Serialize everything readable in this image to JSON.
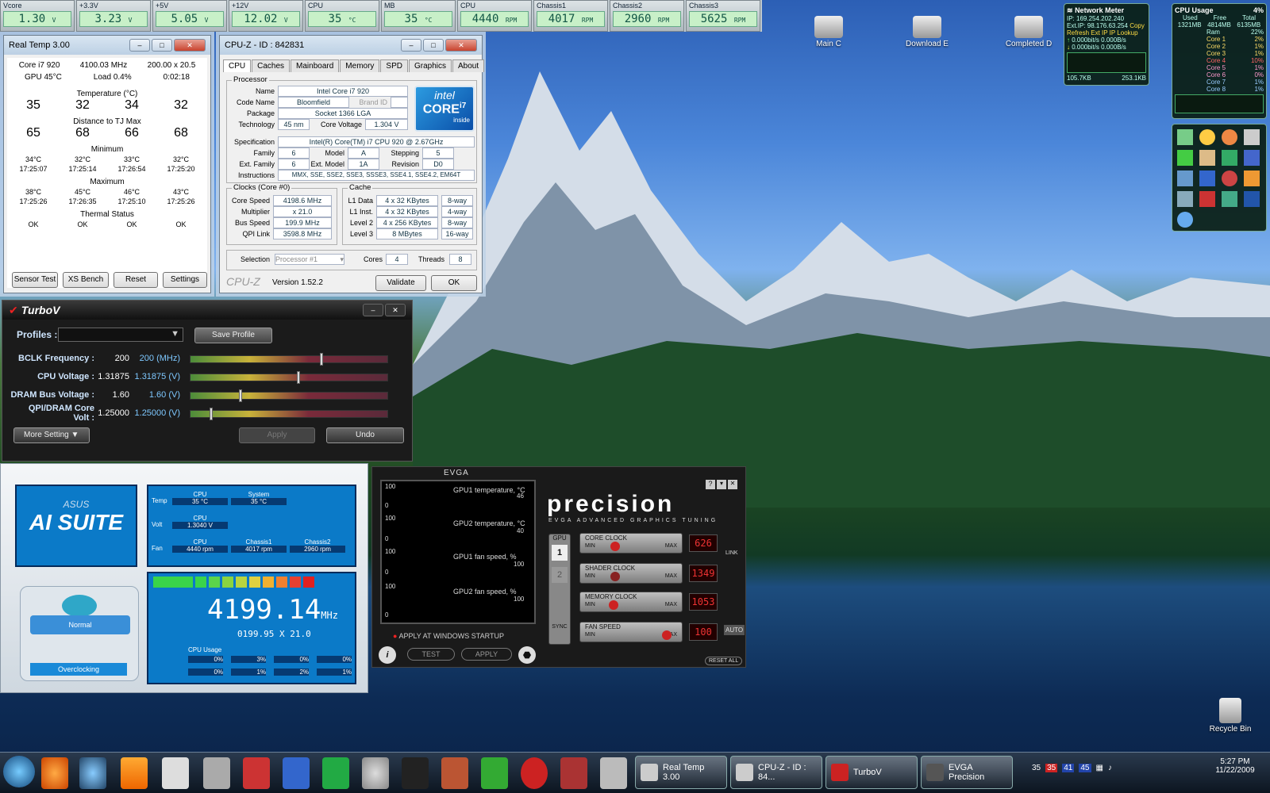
{
  "sensors": [
    {
      "label": "Vcore",
      "value": "1.30",
      "unit": "V"
    },
    {
      "label": "+3.3V",
      "value": "3.23",
      "unit": "V"
    },
    {
      "label": "+5V",
      "value": "5.05",
      "unit": "V"
    },
    {
      "label": "+12V",
      "value": "12.02",
      "unit": "V"
    },
    {
      "label": "CPU",
      "value": "35",
      "unit": "°C"
    },
    {
      "label": "MB",
      "value": "35",
      "unit": "°C"
    },
    {
      "label": "CPU",
      "value": "4440",
      "unit": "RPM"
    },
    {
      "label": "Chassis1",
      "value": "4017",
      "unit": "RPM"
    },
    {
      "label": "Chassis2",
      "value": "2960",
      "unit": "RPM"
    },
    {
      "label": "Chassis3",
      "value": "5625",
      "unit": "RPM"
    }
  ],
  "realtemp": {
    "title": "Real Temp 3.00",
    "cpu": "Core i7 920",
    "mhz": "4100.03 MHz",
    "mult": "200.00 x 20.5",
    "gpu": "GPU 45°C",
    "load": "Load 0.4%",
    "time": "0:02:18",
    "temp_label": "Temperature (°C)",
    "temps": [
      "35",
      "32",
      "34",
      "32"
    ],
    "dist_label": "Distance to TJ Max",
    "dist": [
      "65",
      "68",
      "66",
      "68"
    ],
    "min_label": "Minimum",
    "min_t": [
      "34°C",
      "32°C",
      "33°C",
      "32°C"
    ],
    "min_time": [
      "17:25:07",
      "17:25:14",
      "17:26:54",
      "17:25:20"
    ],
    "max_label": "Maximum",
    "max_t": [
      "38°C",
      "45°C",
      "46°C",
      "43°C"
    ],
    "max_time": [
      "17:25:26",
      "17:26:35",
      "17:25:10",
      "17:25:26"
    ],
    "thermal_label": "Thermal Status",
    "thermal": [
      "OK",
      "OK",
      "OK",
      "OK"
    ],
    "buttons": [
      "Sensor Test",
      "XS Bench",
      "Reset",
      "Settings"
    ]
  },
  "cpuz": {
    "title": "CPU-Z - ID : 842831",
    "tabs": [
      "CPU",
      "Caches",
      "Mainboard",
      "Memory",
      "SPD",
      "Graphics",
      "About"
    ],
    "proc_label": "Processor",
    "name_l": "Name",
    "name": "Intel Core i7 920",
    "code_l": "Code Name",
    "code": "Bloomfield",
    "brand_l": "Brand ID",
    "pkg_l": "Package",
    "pkg": "Socket 1366 LGA",
    "tech_l": "Technology",
    "tech": "45 nm",
    "cv_l": "Core Voltage",
    "cv": "1.304 V",
    "spec_l": "Specification",
    "spec": "Intel(R) Core(TM) i7 CPU     920  @ 2.67GHz",
    "fam_l": "Family",
    "fam": "6",
    "model_l": "Model",
    "model": "A",
    "step_l": "Stepping",
    "step": "5",
    "efam_l": "Ext. Family",
    "efam": "6",
    "emodel_l": "Ext. Model",
    "emodel": "1A",
    "rev_l": "Revision",
    "rev": "D0",
    "instr_l": "Instructions",
    "instr": "MMX, SSE, SSE2, SSE3, SSSE3, SSE4.1, SSE4.2, EM64T",
    "clocks_label": "Clocks (Core #0)",
    "cs_l": "Core Speed",
    "cs": "4198.6 MHz",
    "mul_l": "Multiplier",
    "mul": "x 21.0",
    "bs_l": "Bus Speed",
    "bs": "199.9 MHz",
    "qpi_l": "QPI Link",
    "qpi": "3598.8 MHz",
    "cache_label": "Cache",
    "l1d_l": "L1 Data",
    "l1d": "4 x 32 KBytes",
    "l1d_w": "8-way",
    "l1i_l": "L1 Inst.",
    "l1i": "4 x 32 KBytes",
    "l1i_w": "4-way",
    "l2_l": "Level 2",
    "l2": "4 x 256 KBytes",
    "l2_w": "8-way",
    "l3_l": "Level 3",
    "l3": "8 MBytes",
    "l3_w": "16-way",
    "sel_l": "Selection",
    "sel": "Processor #1",
    "cores_l": "Cores",
    "cores": "4",
    "thr_l": "Threads",
    "thr": "8",
    "brand": "CPU-Z",
    "version": "Version 1.52.2",
    "validate": "Validate",
    "ok": "OK",
    "logo_top": "intel",
    "logo_mid": "CORE",
    "logo_i7": "i7",
    "logo_bot": "inside"
  },
  "turbov": {
    "title": "TurboV",
    "profiles_l": "Profiles :",
    "save": "Save Profile",
    "rows": [
      {
        "label": "BCLK Frequency :",
        "value": "200",
        "set": "200 (MHz)",
        "level": 0.67
      },
      {
        "label": "CPU Voltage :",
        "value": "1.31875",
        "set": "1.31875 (V)",
        "level": 0.55
      },
      {
        "label": "DRAM Bus Voltage :",
        "value": "1.60",
        "set": "1.60 (V)",
        "level": 0.25
      },
      {
        "label": "QPI/DRAM Core Volt :",
        "value": "1.25000",
        "set": "1.25000 (V)",
        "level": 0.1
      }
    ],
    "more": "More Setting",
    "apply": "Apply",
    "undo": "Undo"
  },
  "aisuite": {
    "logo_top": "ASUS",
    "logo": "AI SUITE",
    "temp_l": "Temp",
    "volt_l": "Volt",
    "fan_l": "Fan",
    "cpu_l": "CPU",
    "sys_l": "System",
    "ch1_l": "Chassis1",
    "ch2_l": "Chassis2",
    "cpu_t": "35 °C",
    "sys_t": "35 °C",
    "cpu_v": "1.3040  V",
    "cpu_f": "4440  rpm",
    "ch1_f": "4017  rpm",
    "ch2_f": "2960  rpm",
    "freq": "4199.14",
    "freq_unit": "MHz",
    "freq_sub": "0199.95  X  21.0",
    "usage_l": "CPU Usage",
    "usage_row1": [
      "0%",
      "3%",
      "0%",
      "0%"
    ],
    "usage_row2": [
      "0%",
      "1%",
      "2%",
      "1%"
    ],
    "mode": "Normal",
    "oc": "Overclocking"
  },
  "evga": {
    "brand": "EVGA",
    "graphs": [
      {
        "label": "GPU1 temperature, °C",
        "top": "100",
        "bot": "0",
        "cur": "46"
      },
      {
        "label": "GPU2 temperature, °C",
        "top": "100",
        "bot": "0",
        "cur": "40"
      },
      {
        "label": "GPU1 fan speed, %",
        "top": "100",
        "bot": "0",
        "cur": "100"
      },
      {
        "label": "GPU2 fan speed, %",
        "top": "100",
        "bot": "0",
        "cur": "100"
      }
    ],
    "startup": "APPLY AT WINDOWS STARTUP",
    "test": "TEST",
    "apply": "APPLY",
    "title": "precision",
    "subtitle": "EVGA ADVANCED GRAPHICS TUNING",
    "gpu_l": "GPU",
    "gpu1": "1",
    "gpu2": "2",
    "sync": "SYNC",
    "link": "LINK",
    "auto": "AUTO",
    "reset": "RESET ALL",
    "sliders": [
      {
        "label": "CORE CLOCK",
        "val": "626",
        "level": 0.3
      },
      {
        "label": "SHADER CLOCK",
        "val": "1349",
        "level": 0.3
      },
      {
        "label": "MEMORY CLOCK",
        "val": "1053",
        "level": 0.28
      },
      {
        "label": "FAN SPEED",
        "val": "100",
        "level": 0.95
      }
    ],
    "min": "MIN",
    "max": "MAX"
  },
  "network": {
    "title": "Network Meter",
    "ip": "IP: 169.254.202.240",
    "extip": "Ext.IP: 98.176.63.254",
    "copy": "Copy",
    "refresh": "Refresh Ext IP",
    "lookup": "IP Lookup",
    "up": "0.000bit/s",
    "up2": "0.000B/s",
    "down": "0.000bit/s",
    "down2": "0.000B/s",
    "tot_up": "105.7KB",
    "tot_down": "253.1KB"
  },
  "cpuusage": {
    "title": "CPU Usage",
    "pct": "4%",
    "used_l": "Used",
    "free_l": "Free",
    "total_l": "Total",
    "used": "1321MB",
    "free": "4814MB",
    "total": "6135MB",
    "rows": [
      {
        "l": "Ram",
        "v": "22%"
      },
      {
        "l": "Core 1",
        "v": "2%"
      },
      {
        "l": "Core 2",
        "v": "1%"
      },
      {
        "l": "Core 3",
        "v": "1%"
      },
      {
        "l": "Core 4",
        "v": "10%"
      },
      {
        "l": "Core 5",
        "v": "1%"
      },
      {
        "l": "Core 6",
        "v": "0%"
      },
      {
        "l": "Core 7",
        "v": "1%"
      },
      {
        "l": "Core 8",
        "v": "1%"
      }
    ]
  },
  "desktop": {
    "icons": [
      "Main C",
      "Download E",
      "Completed D"
    ],
    "recycle": "Recycle Bin"
  },
  "taskbar": {
    "tasks": [
      "Real Temp 3.00",
      "CPU-Z - ID : 84...",
      "TurboV",
      "EVGA Precision"
    ],
    "tray": [
      "35",
      "35",
      "41",
      "45"
    ],
    "time": "5:27 PM",
    "date": "11/22/2009",
    "quick": [
      "firefox",
      "thunderbird",
      "vlc",
      "calendar",
      "alien",
      "120x",
      "messenger",
      "utorrent",
      "safari",
      "steam",
      "tf2",
      "l4d",
      "opera",
      "4",
      "astronaut"
    ]
  },
  "colors": {
    "accent": "#0b7ac8",
    "lcd": "#c8f0c8",
    "led_red": "#e33"
  }
}
